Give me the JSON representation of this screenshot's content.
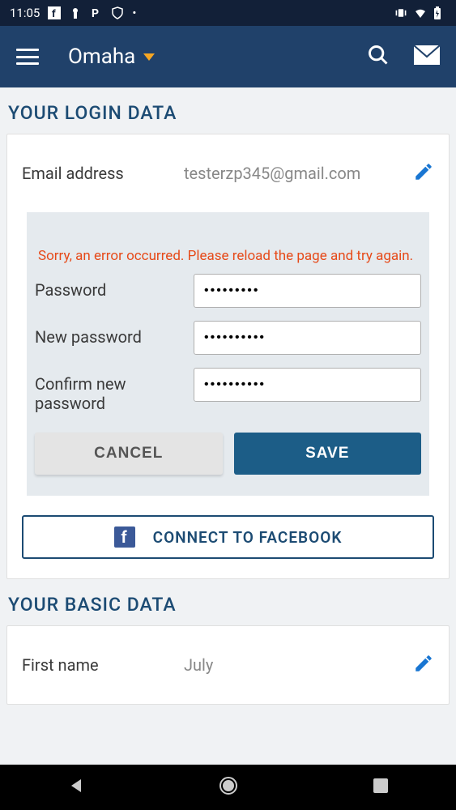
{
  "status": {
    "time": "11:05"
  },
  "header": {
    "location": "Omaha"
  },
  "sections": {
    "login_title": "YOUR LOGIN DATA",
    "basic_title": "YOUR BASIC DATA"
  },
  "login": {
    "email_label": "Email address",
    "email_value": "testerzp345@gmail.com",
    "error": "Sorry, an error occurred. Please reload the page and try again.",
    "password_label": "Password",
    "password_value": "•••••••••",
    "new_password_label": "New password",
    "new_password_value": "••••••••••",
    "confirm_label": "Confirm new password",
    "confirm_value": "••••••••••",
    "cancel": "CANCEL",
    "save": "SAVE",
    "facebook": "CONNECT TO FACEBOOK"
  },
  "basic": {
    "firstname_label": "First name",
    "firstname_value": "July"
  },
  "colors": {
    "accent": "#1c5d87",
    "header_bg": "#20416a",
    "status_bg": "#122038",
    "dropdown": "#f5a623",
    "error": "#e64a19",
    "edit_icon": "#1976d2"
  }
}
